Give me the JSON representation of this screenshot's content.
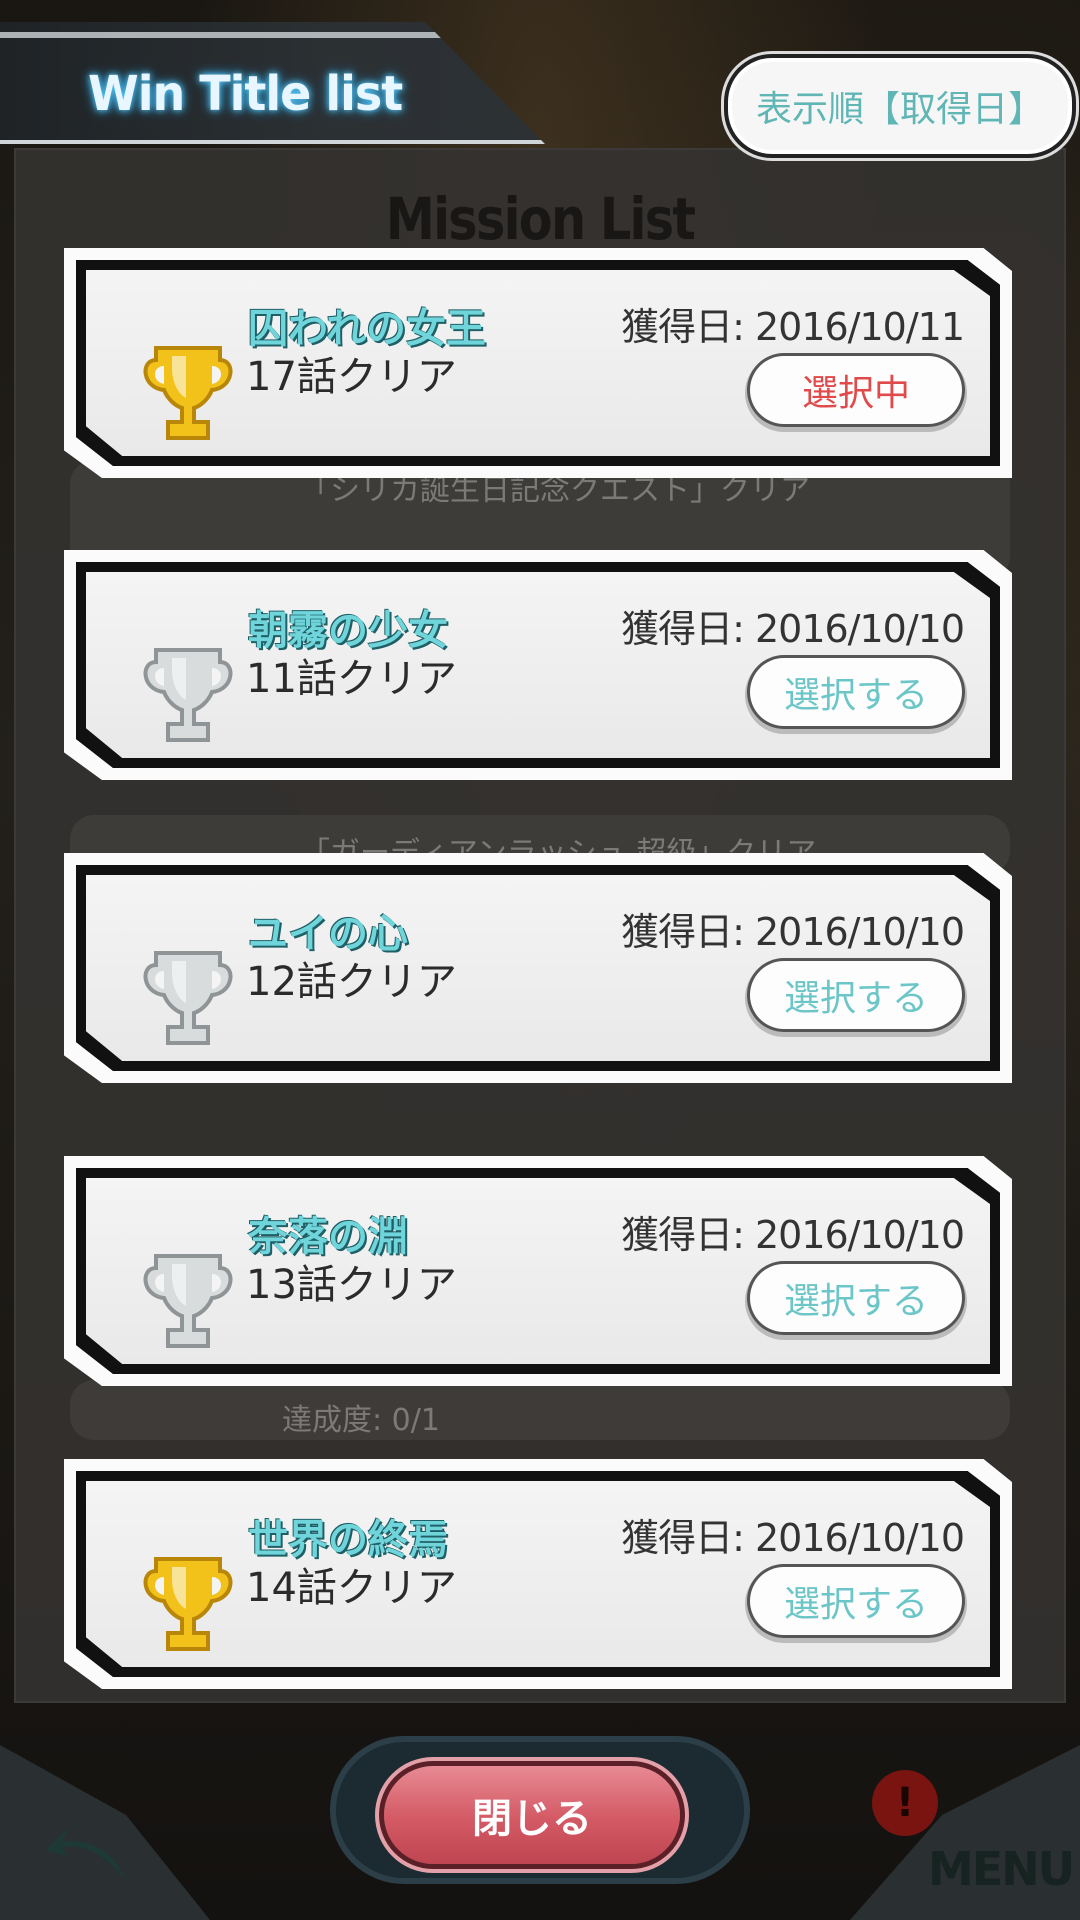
{
  "header": {
    "title": "Win Title list",
    "sort_label": "表示順【取得日】"
  },
  "background": {
    "panel_title": "Mission List",
    "ghost_texts": [
      "「シリカ誕生日記念クエスト」クリア",
      "「ガーディアンラッシュ 超級」クリア",
      "達成度: 0/1"
    ]
  },
  "titles": [
    {
      "name": "囚われの女王",
      "desc": "17話クリア",
      "date": "獲得日: 2016/10/11",
      "button": "選択中",
      "active": true,
      "trophy": "gold-trophy-icon"
    },
    {
      "name": "朝霧の少女",
      "desc": "11話クリア",
      "date": "獲得日: 2016/10/10",
      "button": "選択する",
      "active": false,
      "trophy": "silver-trophy-icon"
    },
    {
      "name": "ユイの心",
      "desc": "12話クリア",
      "date": "獲得日: 2016/10/10",
      "button": "選択する",
      "active": false,
      "trophy": "silver-trophy-icon"
    },
    {
      "name": "奈落の淵",
      "desc": "13話クリア",
      "date": "獲得日: 2016/10/10",
      "button": "選択する",
      "active": false,
      "trophy": "silver-trophy-icon"
    },
    {
      "name": "世界の終焉",
      "desc": "14話クリア",
      "date": "獲得日: 2016/10/10",
      "button": "選択する",
      "active": false,
      "trophy": "gold-trophy-icon"
    }
  ],
  "footer": {
    "close_label": "閉じる",
    "menu_label": "MENU",
    "alert_glyph": "!"
  },
  "colors": {
    "accent_teal": "#6fd5db",
    "active_red": "#e04a4a",
    "gold": "#f2c21b",
    "silver": "#d8dcdd",
    "close_red": "#d35964"
  }
}
